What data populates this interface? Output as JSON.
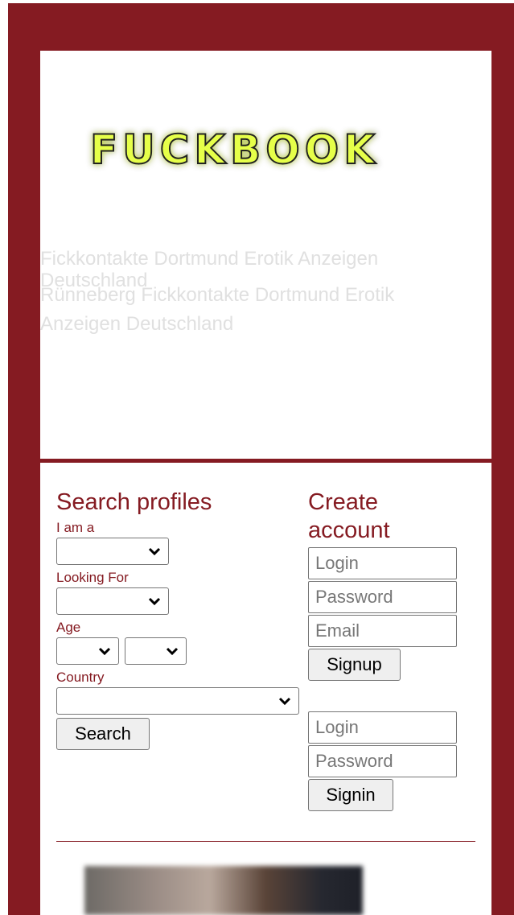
{
  "header": {
    "logo_text": "FUCKBOOK",
    "faded_lines": [
      "Fickkontakte Dortmund Erotik Anzeigen",
      "Deutschland",
      "Rünneberg Fickkontakte Dortmund Erotik",
      "Anzeigen Deutschland"
    ]
  },
  "search": {
    "title": "Search profiles",
    "i_am_label": "I am a",
    "looking_for_label": "Looking For",
    "age_label": "Age",
    "country_label": "Country",
    "search_button": "Search"
  },
  "create": {
    "title_line1": "Create",
    "title_line2": "account",
    "login_placeholder": "Login",
    "password_placeholder": "Password",
    "email_placeholder": "Email",
    "signup_button": "Signup"
  },
  "signin": {
    "login_placeholder": "Login",
    "password_placeholder": "Password",
    "signin_button": "Signin"
  },
  "colors": {
    "brand": "#851b22",
    "logo_fill": "#e6ff4a",
    "logo_glow": "#c8ff00"
  }
}
